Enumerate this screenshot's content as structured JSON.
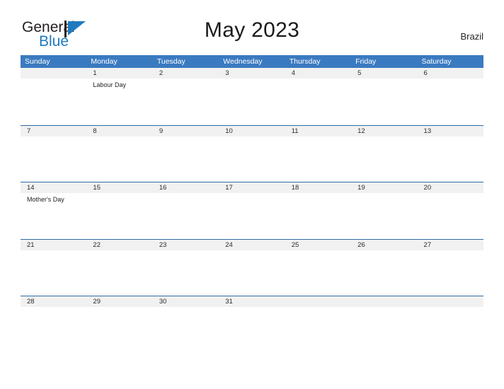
{
  "header": {
    "logo": {
      "text_primary": "General",
      "text_secondary": "Blue",
      "mark": "blue-triangle-flag-icon"
    },
    "title": "May 2023",
    "region": "Brazil"
  },
  "colors": {
    "header_blue": "#3a7ac0",
    "row_divider_blue": "#2e6da4",
    "date_band_gray": "#f1f1f1",
    "logo_blue": "#1f7ac0",
    "title_text": "#1a1a1a"
  },
  "calendar": {
    "day_names": [
      "Sunday",
      "Monday",
      "Tuesday",
      "Wednesday",
      "Thursday",
      "Friday",
      "Saturday"
    ],
    "weeks": [
      {
        "days": [
          {
            "date": "",
            "event": ""
          },
          {
            "date": "1",
            "event": "Labour Day"
          },
          {
            "date": "2",
            "event": ""
          },
          {
            "date": "3",
            "event": ""
          },
          {
            "date": "4",
            "event": ""
          },
          {
            "date": "5",
            "event": ""
          },
          {
            "date": "6",
            "event": ""
          }
        ]
      },
      {
        "days": [
          {
            "date": "7",
            "event": ""
          },
          {
            "date": "8",
            "event": ""
          },
          {
            "date": "9",
            "event": ""
          },
          {
            "date": "10",
            "event": ""
          },
          {
            "date": "11",
            "event": ""
          },
          {
            "date": "12",
            "event": ""
          },
          {
            "date": "13",
            "event": ""
          }
        ]
      },
      {
        "days": [
          {
            "date": "14",
            "event": "Mother's Day"
          },
          {
            "date": "15",
            "event": ""
          },
          {
            "date": "16",
            "event": ""
          },
          {
            "date": "17",
            "event": ""
          },
          {
            "date": "18",
            "event": ""
          },
          {
            "date": "19",
            "event": ""
          },
          {
            "date": "20",
            "event": ""
          }
        ]
      },
      {
        "days": [
          {
            "date": "21",
            "event": ""
          },
          {
            "date": "22",
            "event": ""
          },
          {
            "date": "23",
            "event": ""
          },
          {
            "date": "24",
            "event": ""
          },
          {
            "date": "25",
            "event": ""
          },
          {
            "date": "26",
            "event": ""
          },
          {
            "date": "27",
            "event": ""
          }
        ]
      },
      {
        "days": [
          {
            "date": "28",
            "event": ""
          },
          {
            "date": "29",
            "event": ""
          },
          {
            "date": "30",
            "event": ""
          },
          {
            "date": "31",
            "event": ""
          },
          {
            "date": "",
            "event": ""
          },
          {
            "date": "",
            "event": ""
          },
          {
            "date": "",
            "event": ""
          }
        ]
      }
    ]
  }
}
